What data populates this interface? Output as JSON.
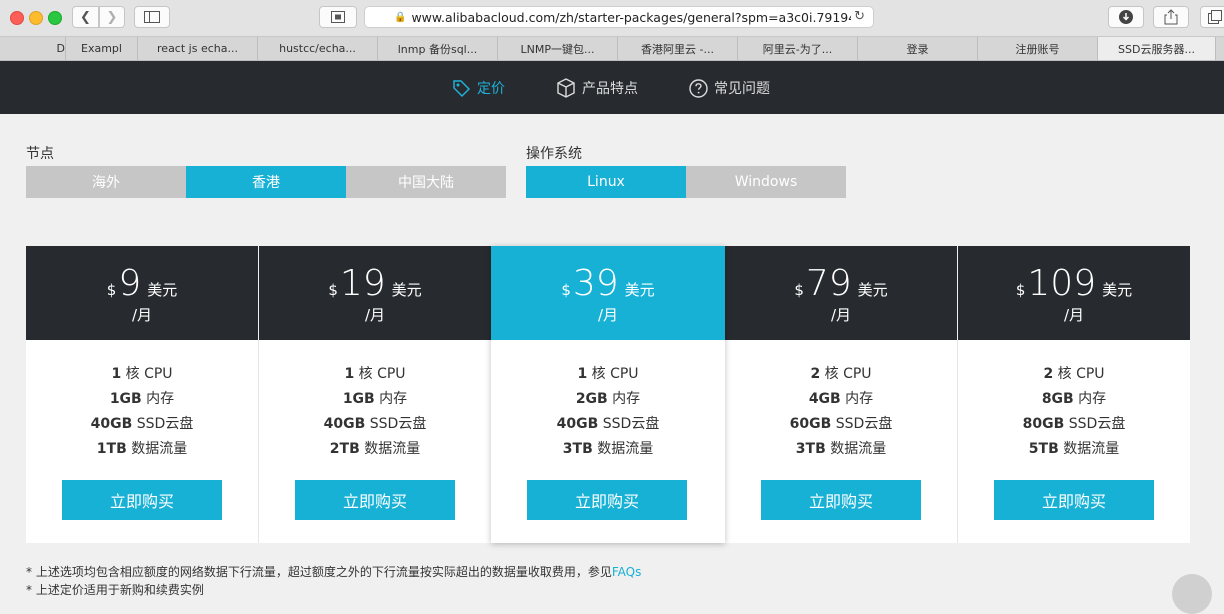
{
  "browser": {
    "url_main": "www.alibabacloud.com/zh/starter-packages/general?spm=a3c0i.7919406.7",
    "url_faded": "0",
    "tabs": [
      {
        "label": "D",
        "width": 66
      },
      {
        "label": "Exampl",
        "width": 72
      },
      {
        "label": "react js echa...",
        "width": 120
      },
      {
        "label": "hustcc/echa...",
        "width": 120
      },
      {
        "label": "lnmp 备份sql...",
        "width": 120
      },
      {
        "label": "LNMP一键包...",
        "width": 120
      },
      {
        "label": "香港阿里云 -...",
        "width": 120
      },
      {
        "label": "阿里云-为了...",
        "width": 120
      },
      {
        "label": "登录",
        "width": 120
      },
      {
        "label": "注册账号",
        "width": 120
      },
      {
        "label": "SSD云服务器...",
        "width": 118
      }
    ]
  },
  "nav": {
    "pricing": "定价",
    "features": "产品特点",
    "faq": "常见问题"
  },
  "filters": {
    "region_label": "节点",
    "regions": [
      "海外",
      "香港",
      "中国大陆"
    ],
    "os_label": "操作系统",
    "os": [
      "Linux",
      "Windows"
    ]
  },
  "plans": [
    {
      "price": "9",
      "cpu": "1",
      "mem": "1GB",
      "disk": "40GB",
      "traffic": "1TB"
    },
    {
      "price": "19",
      "cpu": "1",
      "mem": "1GB",
      "disk": "40GB",
      "traffic": "2TB"
    },
    {
      "price": "39",
      "cpu": "1",
      "mem": "2GB",
      "disk": "40GB",
      "traffic": "3TB"
    },
    {
      "price": "79",
      "cpu": "2",
      "mem": "4GB",
      "disk": "60GB",
      "traffic": "3TB"
    },
    {
      "price": "109",
      "cpu": "2",
      "mem": "8GB",
      "disk": "80GB",
      "traffic": "5TB"
    }
  ],
  "plan_text": {
    "currency": "$",
    "unit": "美元",
    "per": "/月",
    "cpu_suffix": "核 CPU",
    "mem_suffix": "内存",
    "disk_suffix": "SSD云盘",
    "traffic_suffix": "数据流量",
    "buy": "立即购买"
  },
  "notes": {
    "line1": "上述选项均包含相应额度的网络数据下行流量，超过额度之外的下行流量按实际超出的数据量收取费用，参见",
    "faq_link": "FAQs",
    "line2": "上述定价适用于新购和续费实例",
    "bullet": "*"
  },
  "colors": {
    "accent": "#17b1d6",
    "dark": "#272a2e",
    "inactive": "#c6c6c6"
  }
}
